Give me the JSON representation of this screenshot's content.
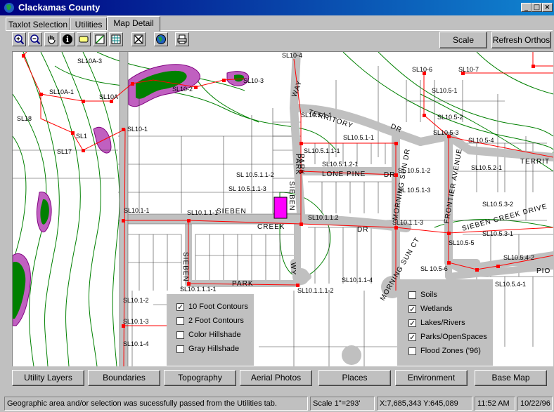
{
  "window": {
    "title": "Clackamas County",
    "minimize_label": "_",
    "maximize_label": "□",
    "close_label": "×"
  },
  "tabs": [
    {
      "label": "Taxlot Selection"
    },
    {
      "label": "Utilities"
    },
    {
      "label": "Map Detail"
    }
  ],
  "toolbar": {
    "tools": [
      "zoom-in-icon",
      "zoom-out-icon",
      "pan-hand-icon",
      "info-icon",
      "label-icon",
      "measure-icon",
      "grid-icon",
      "clear-selection-icon",
      "globe-icon",
      "print-icon"
    ],
    "scale_label": "Scale",
    "refresh_label": "Refresh Orthos"
  },
  "map": {
    "labels": [
      "SL10A-3",
      "SL10A-1",
      "SL10A",
      "SL18",
      "SL17",
      "SL10-4",
      "SL10-2",
      "SL10-3",
      "SL10-1",
      "SL10-6",
      "SL10-7",
      "SL10.5-1",
      "SL10.5-2",
      "SL10.5-3",
      "SL10.5-4",
      "SL10.5.1-1",
      "SL10.5.1-1",
      "SL10.5.1.1-1",
      "SL10.5.1.2-1",
      "SL 10.5.1.1-2",
      "SL 10.5.1.1-3",
      "SL10.1-1",
      "SL10.1.1-1",
      "SL10.1-2",
      "SL10.1-3",
      "SL10.1-4",
      "SL10.1.1.2",
      "SL10.1.1-3",
      "SL10.1.1-4",
      "SL10.1.1.1-2",
      "SL10.1.1.1-1",
      "SL10.5.2-1",
      "SL 10.5.1-2",
      "SL 10.5.1-3",
      "SL10.5.3-2",
      "SL10.5.3-1",
      "SL10.5-5",
      "SL10.5.4-2",
      "SL 10.5-6",
      "SL10.5.4-1",
      "SL1"
    ],
    "streets": [
      "WAY",
      "TERRITORY",
      "DR",
      "PARK",
      "LONE PINE",
      "DR",
      "SIEBEN",
      "SIEBEN",
      "CREEK",
      "DR",
      "SIEBEN",
      "PARK",
      "WY",
      "MORNING SUN DR",
      "FRONTIER AVENUE",
      "SIEBEN CREEK DRIVE",
      "TERRIT",
      "MORNING SUN CT",
      "PIO",
      "PARK"
    ]
  },
  "layers_left": [
    {
      "label": "10 Foot Contours",
      "checked": true
    },
    {
      "label": "2 Foot Contours",
      "checked": false
    },
    {
      "label": "Color Hillshade",
      "checked": false
    },
    {
      "label": "Gray Hillshade",
      "checked": false
    }
  ],
  "layers_right": [
    {
      "label": "Soils",
      "checked": false
    },
    {
      "label": "Wetlands",
      "checked": true
    },
    {
      "label": "Lakes/Rivers",
      "checked": true
    },
    {
      "label": "Parks/OpenSpaces",
      "checked": true
    },
    {
      "label": "Flood Zones ('96)",
      "checked": false
    }
  ],
  "bottom_buttons": [
    "Utility Layers",
    "Boundaries",
    "Topography",
    "Aerial Photos",
    "Places",
    "Environment",
    "Base Map"
  ],
  "status": {
    "message": "Geographic area and/or selection was sucessfully passed from the Utilities tab.",
    "scale": "Scale 1\"=293'",
    "coords": "X:7,685,343  Y:645,089",
    "time": "11:52 AM",
    "date": "10/22/96"
  },
  "colors": {
    "titlebar": "#000080",
    "road": "#c0c0c0",
    "contour": "#008000",
    "wetland": "#c060c0",
    "lake": "#008000",
    "sewer_line": "#ff0000",
    "selected_lot": "#ff00ff"
  }
}
